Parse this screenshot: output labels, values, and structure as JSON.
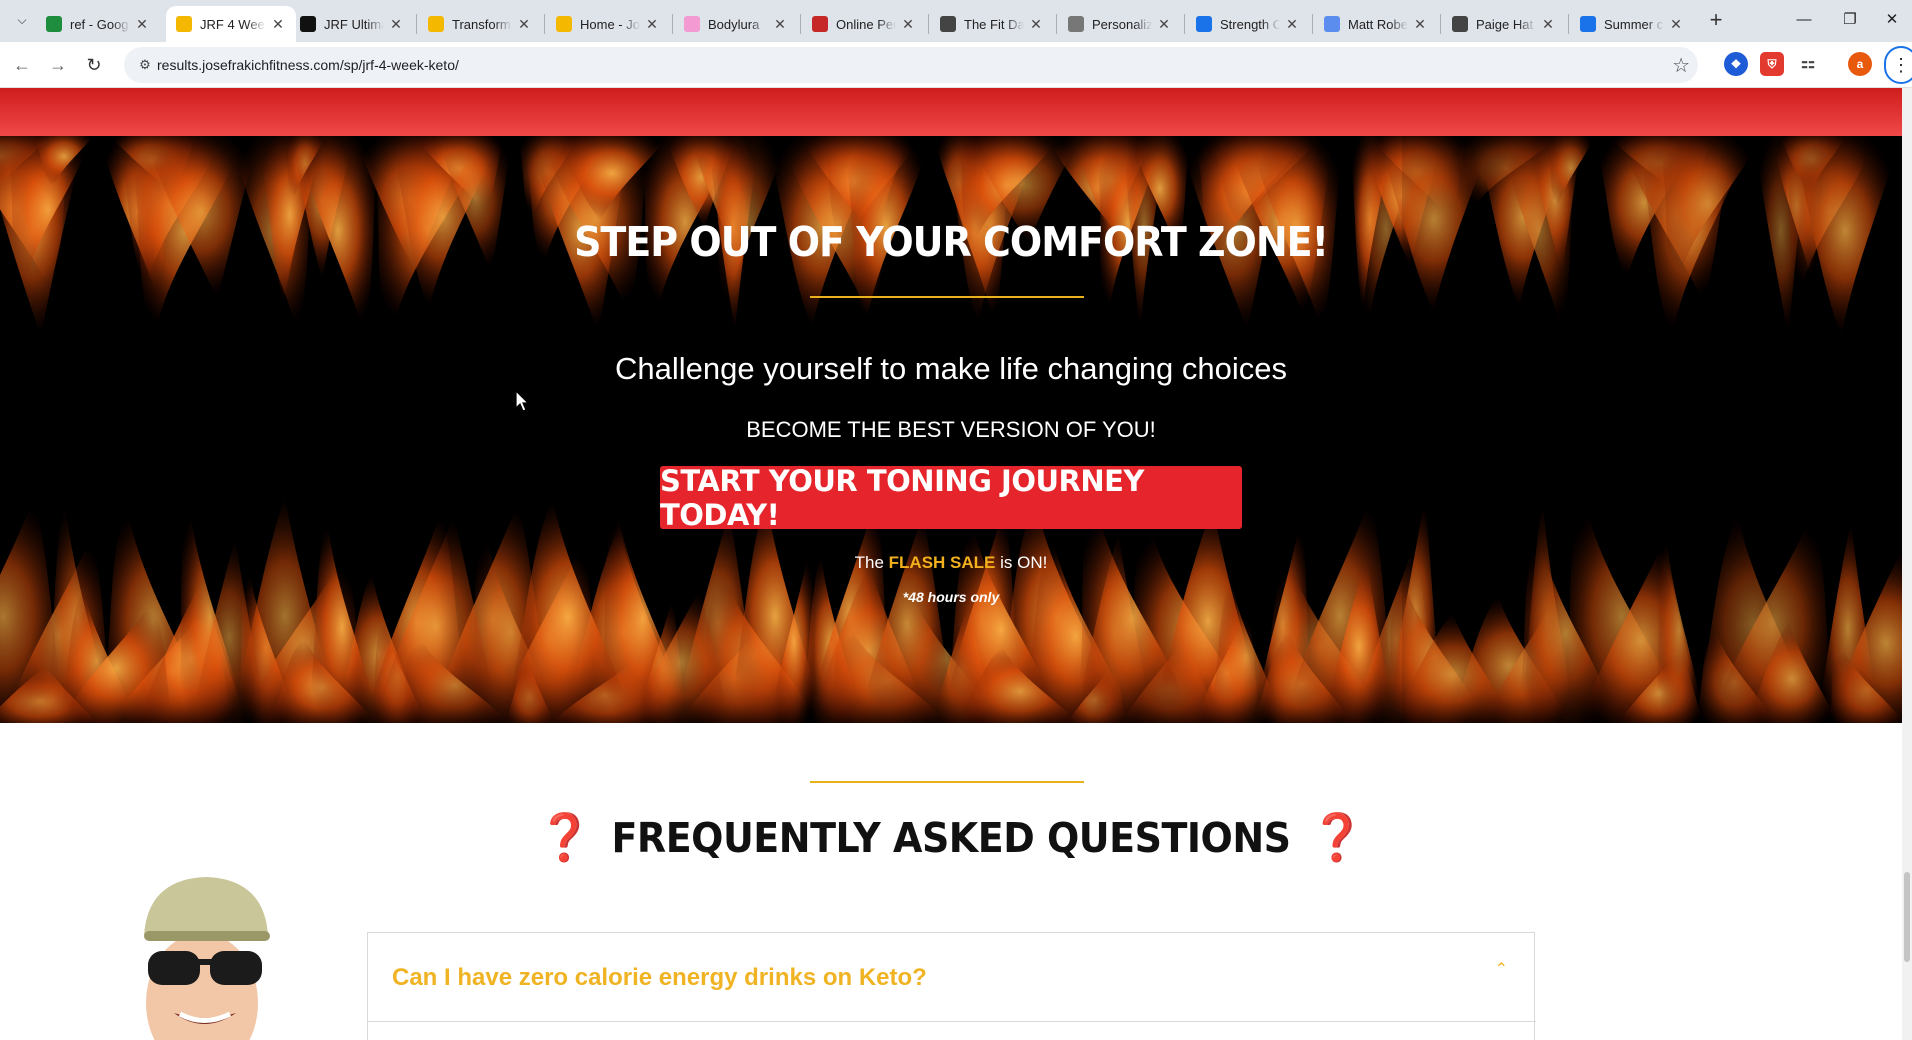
{
  "browser": {
    "tabs": [
      {
        "title": "ref - Goog",
        "favicon": "sheets-icon",
        "color": "#1e8e3e"
      },
      {
        "title": "JRF 4 Wee",
        "favicon": "jrf-icon",
        "color": "#f5b800",
        "active": true
      },
      {
        "title": "JRF Ultima",
        "favicon": "jrf-icon",
        "color": "#111"
      },
      {
        "title": "Transform",
        "favicon": "jrf-icon",
        "color": "#f5b800"
      },
      {
        "title": "Home - Jo",
        "favicon": "jrf-icon",
        "color": "#f5b800"
      },
      {
        "title": "Bodylura",
        "favicon": "bodylura-icon",
        "color": "#f29ad1"
      },
      {
        "title": "Online Per",
        "favicon": "site-icon",
        "color": "#c62828"
      },
      {
        "title": "The Fit Da",
        "favicon": "globe-icon",
        "color": "#444"
      },
      {
        "title": "Personaliz",
        "favicon": "globe-icon",
        "color": "#777"
      },
      {
        "title": "Strength C",
        "favicon": "s-icon",
        "color": "#1a73e8"
      },
      {
        "title": "Matt Robe",
        "favicon": "m-icon",
        "color": "#5b8def"
      },
      {
        "title": "Paige Hat",
        "favicon": "globe-icon",
        "color": "#444"
      },
      {
        "title": "Summer c",
        "favicon": "b-icon",
        "color": "#1a73e8"
      }
    ],
    "url": "results.josefrakichfitness.com/sp/jrf-4-week-keto/",
    "profile_initial": "a"
  },
  "hero": {
    "title": "STEP OUT OF YOUR COMFORT ZONE!",
    "subtitle": "Challenge yourself to make life changing choices",
    "tagline": "BECOME THE BEST VERSION OF YOU!",
    "cta_label": "START YOUR TONING JOURNEY TODAY!",
    "flash_pre": "The",
    "flash_highlight": "FLASH SALE",
    "flash_post": "is ON!",
    "hours_note": "*48 hours only"
  },
  "faq": {
    "title": "FREQUENTLY ASKED QUESTIONS",
    "question_mark": "❓",
    "items": [
      {
        "question": "Can I have zero calorie energy drinks on Keto?",
        "expanded": true
      }
    ]
  },
  "colors": {
    "accent_red": "#e5252b",
    "gold": "#f0b323",
    "faq_question_mark": "#c8102e"
  }
}
